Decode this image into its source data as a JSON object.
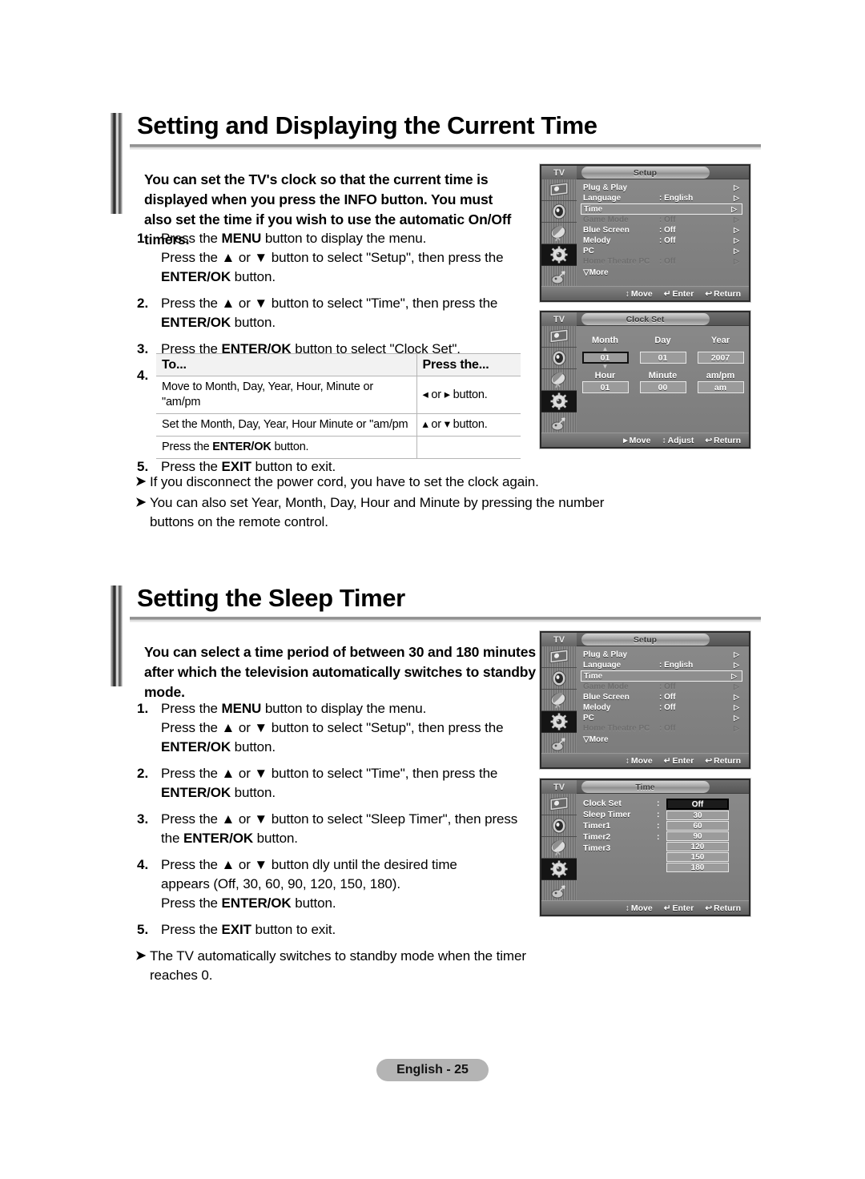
{
  "footer": {
    "page_label": "English - 25"
  },
  "sections": [
    {
      "title": "Setting and Displaying the Current Time",
      "intro": "You can set the TV's clock so that the current time is displayed when you press the INFO button. You must also set the time if you wish to use the automatic On/Off timers.",
      "steps": [
        {
          "num": "1.",
          "lines": [
            "Press the <b>MENU</b> button to display the menu.",
            "Press the ▲ or ▼ button to select \"Setup\", then press the",
            "<b>ENTER/OK</b> button."
          ]
        },
        {
          "num": "2.",
          "lines": [
            "Press the ▲ or ▼ button to select \"Time\", then press the",
            "<b>ENTER/OK</b> button."
          ]
        },
        {
          "num": "3.",
          "lines": [
            "Press the <b>ENTER/OK</b> button to select \"Clock Set\"."
          ]
        },
        {
          "num": "4.",
          "lines": []
        },
        {
          "num": "5.",
          "lines": [
            "Press the <b>EXIT</b> button to exit."
          ]
        }
      ],
      "table": {
        "headers": [
          "To...",
          "Press the..."
        ],
        "rows": [
          {
            "to": "Move to Month, Day, Year, Hour, Minute or \"am/pm",
            "press": "◂ or ▸ button."
          },
          {
            "to": "Set the Month, Day, Year, Hour Minute or \"am/pm",
            "press": "▴ or ▾ button."
          },
          {
            "to": "Press the <b>ENTER/OK</b> button.",
            "press": ""
          }
        ]
      },
      "notes": [
        "If you disconnect the power cord, you have to set the clock again.",
        "You can also set Year, Month, Day, Hour and Minute by pressing the number buttons on the remote control."
      ]
    },
    {
      "title": "Setting the Sleep Timer",
      "intro": "You can select a time period of between 30 and 180 minutes after which the television automatically switches to standby mode.",
      "steps": [
        {
          "num": "1.",
          "lines": [
            "Press the <b>MENU</b> button to display the menu.",
            "Press the ▲ or ▼ button to select \"Setup\", then press the",
            "<b>ENTER/OK</b> button."
          ]
        },
        {
          "num": "2.",
          "lines": [
            "Press the ▲ or ▼ button to select \"Time\", then press the",
            "<b>ENTER/OK</b> button."
          ]
        },
        {
          "num": "3.",
          "lines": [
            "Press the ▲ or ▼ button to select \"Sleep Timer\", then press",
            "the <b>ENTER/OK</b> button."
          ]
        },
        {
          "num": "4.",
          "lines": [
            "Press the ▲ or ▼ button  dly until the desired time",
            "appears (Off, 30, 60, 90, 120, 150, 180).",
            "Press the <b>ENTER/OK</b> button."
          ]
        },
        {
          "num": "5.",
          "lines": [
            "Press the <b>EXIT</b> button to exit."
          ]
        }
      ],
      "notes": [
        "The TV automatically switches to standby mode when the timer reaches 0."
      ]
    }
  ],
  "osd": {
    "tv_label": "TV",
    "setup_panel": {
      "title": "Setup",
      "items": [
        {
          "label": "Plug & Play",
          "value": "",
          "state": "normal",
          "arrow": "▷"
        },
        {
          "label": "Language",
          "value": ": English",
          "state": "normal",
          "arrow": "▷"
        },
        {
          "label": "Time",
          "value": "",
          "state": "highlight",
          "arrow": "▷"
        },
        {
          "label": "Game Mode",
          "value": ": Off",
          "state": "dim",
          "arrow": "▷"
        },
        {
          "label": "Blue Screen",
          "value": ": Off",
          "state": "normal",
          "arrow": "▷"
        },
        {
          "label": "Melody",
          "value": ": Off",
          "state": "normal",
          "arrow": "▷"
        },
        {
          "label": "PC",
          "value": "",
          "state": "normal",
          "arrow": "▷"
        },
        {
          "label": "Home Theatre PC",
          "value": ": Off",
          "state": "dim",
          "arrow": "▷"
        },
        {
          "label": "▽More",
          "value": "",
          "state": "normal",
          "arrow": ""
        }
      ],
      "footer": [
        {
          "icon": "↕",
          "label": "Move"
        },
        {
          "icon": "↵",
          "label": "Enter"
        },
        {
          "icon": "↩",
          "label": "Return"
        }
      ]
    },
    "clock_set_panel": {
      "title": "Clock Set",
      "fields_row1": [
        {
          "label": "Month",
          "value": "01",
          "selected": true
        },
        {
          "label": "Day",
          "value": "01",
          "selected": false
        },
        {
          "label": "Year",
          "value": "2007",
          "selected": false
        }
      ],
      "fields_row2": [
        {
          "label": "Hour",
          "value": "01",
          "selected": false
        },
        {
          "label": "Minute",
          "value": "00",
          "selected": false
        },
        {
          "label": "am/pm",
          "value": "am",
          "selected": false
        }
      ],
      "footer": [
        {
          "icon": "▸",
          "label": "Move"
        },
        {
          "icon": "↕",
          "label": "Adjust"
        },
        {
          "icon": "↩",
          "label": "Return"
        }
      ]
    },
    "time_panel": {
      "title": "Time",
      "items": [
        {
          "label": "Clock Set",
          "colon": ":"
        },
        {
          "label": "Sleep Timer",
          "colon": ":"
        },
        {
          "label": "Timer1",
          "colon": ":"
        },
        {
          "label": "Timer2",
          "colon": ":"
        },
        {
          "label": "Timer3",
          "colon": ""
        }
      ],
      "options": [
        {
          "value": "Off",
          "selected": true
        },
        {
          "value": "30",
          "selected": false
        },
        {
          "value": "60",
          "selected": false
        },
        {
          "value": "90",
          "selected": false
        },
        {
          "value": "120",
          "selected": false
        },
        {
          "value": "150",
          "selected": false
        },
        {
          "value": "180",
          "selected": false
        }
      ],
      "footer": [
        {
          "icon": "↕",
          "label": "Move"
        },
        {
          "icon": "↵",
          "label": "Enter"
        },
        {
          "icon": "↩",
          "label": "Return"
        }
      ]
    },
    "sidebar_icons": [
      "picture-icon",
      "sound-icon",
      "channel-icon",
      "setup-icon",
      "input-icon"
    ]
  }
}
